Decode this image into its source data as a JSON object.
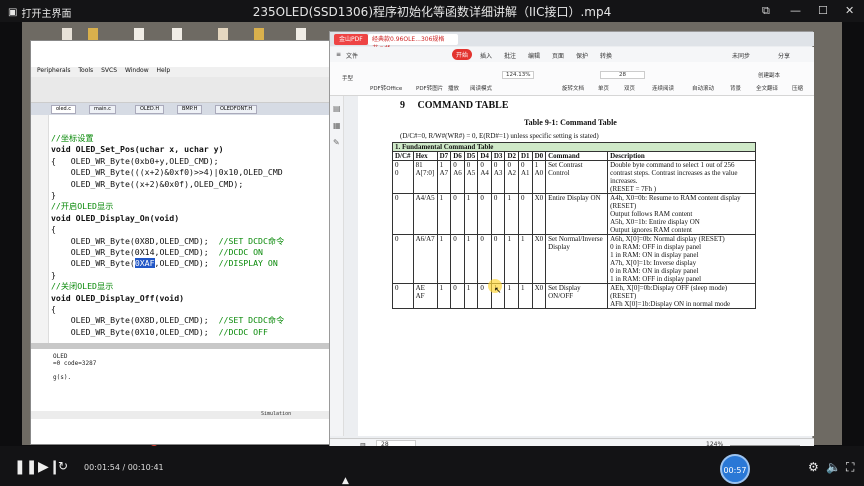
{
  "window": {
    "title": "235OLED(SSD1306)程序初始化等函数详细讲解（IIC接口）.mp4",
    "home_label": "打开主界面"
  },
  "ide": {
    "menu": [
      "Peripherals",
      "Tools",
      "SVCS",
      "Window",
      "Help"
    ],
    "tabs": [
      "oled.c",
      "main.c",
      "OLED.H",
      "BMP.H",
      "OLEDFONT.H"
    ],
    "code_lines": [
      {
        "type": "comment",
        "text": "//坐标设置"
      },
      {
        "type": "kw",
        "text": "void OLED_Set_Pos(uchar x, uchar y)"
      },
      {
        "type": "plain",
        "text": "{   OLED_WR_Byte(0xb0+y,OLED_CMD);"
      },
      {
        "type": "plain",
        "text": "    OLED_WR_Byte(((x+2)&0xf0)>>4)|0x10,OLED_CMD"
      },
      {
        "type": "plain",
        "text": "    OLED_WR_Byte((x+2)&0x0f),OLED_CMD);"
      },
      {
        "type": "plain",
        "text": "}"
      },
      {
        "type": "comment",
        "text": "//开启OLED显示"
      },
      {
        "type": "kw",
        "text": "void OLED_Display_On(void)"
      },
      {
        "type": "plain",
        "text": "{"
      },
      {
        "type": "mixed",
        "pre": "    OLED_WR_Byte(0X8D,OLED_CMD);  ",
        "post": "//SET DCDC命令"
      },
      {
        "type": "mixed",
        "pre": "    OLED_WR_Byte(0X14,OLED_CMD);  ",
        "post": "//DCDC ON"
      },
      {
        "type": "hl",
        "pre": "    OLED_WR_Byte(",
        "hl": "0XAF",
        "mid": ",OLED_CMD);  ",
        "post": "//DISPLAY ON"
      },
      {
        "type": "plain",
        "text": "}"
      },
      {
        "type": "comment",
        "text": "//关闭OLED显示"
      },
      {
        "type": "kw",
        "text": "void OLED_Display_Off(void)"
      },
      {
        "type": "plain",
        "text": "{"
      },
      {
        "type": "mixed",
        "pre": "    OLED_WR_Byte(0X8D,OLED_CMD);  ",
        "post": "//SET DCDC命令"
      },
      {
        "type": "mixed",
        "pre": "    OLED_WR_Byte(0X10,OLED_CMD);  ",
        "post": "//DCDC OFF"
      }
    ],
    "build_output": [
      "OLED",
      "=0  code=3287",
      "",
      "g(s)."
    ],
    "status": "Simulation"
  },
  "pdf": {
    "wps_tab": "金山PDF",
    "doc_tab": "经典款0.96OLE...306规格书.pdf",
    "menu": [
      "文件",
      "开始",
      "插入",
      "批注",
      "编辑",
      "页面",
      "保护",
      "转换"
    ],
    "menu_right": [
      "未同步",
      "分享"
    ],
    "ribbon": [
      "手型",
      "PDF转Office",
      "PDF转图片",
      "播放",
      "阅读模式",
      "124.13%",
      "旋转文档",
      "单页",
      "双页",
      "连续阅读",
      "自动滚动",
      "背景",
      "全文翻译",
      "压缩",
      "创建副本"
    ],
    "page_input": "28",
    "section": "9     COMMAND TABLE",
    "table_title": "Table 9-1: Command Table",
    "table_subtitle": "(D/C#=0, R/W#(WR#) = 0, E(RD#=1) unless specific setting is stated)",
    "fundamental": "1. Fundamental Command Table",
    "headers": [
      "D/C#",
      "Hex",
      "D7",
      "D6",
      "D5",
      "D4",
      "D3",
      "D2",
      "D1",
      "D0",
      "Command",
      "Description"
    ],
    "rows": [
      {
        "dc": "0\n0",
        "hex": "81\nA[7:0]",
        "bits": [
          "1\nA7",
          "0\nA6",
          "0\nA5",
          "0\nA4",
          "0\nA3",
          "0\nA2",
          "0\nA1",
          "1\nA0"
        ],
        "cmd": "Set Contrast Control",
        "desc": "Double byte command to select 1 out of 256 contrast steps. Contrast increases as the value increases.\n(RESET = 7Fh )"
      },
      {
        "dc": "0",
        "hex": "A4/A5",
        "bits": [
          "1",
          "0",
          "1",
          "0",
          "0",
          "1",
          "0",
          "X0"
        ],
        "cmd": "Entire Display ON",
        "desc": "A4h, X0=0b: Resume to RAM content display (RESET)\n   Output follows RAM content\nA5h, X0=1b: Entire display ON\n   Output ignores RAM content"
      },
      {
        "dc": "0",
        "hex": "A6/A7",
        "bits": [
          "1",
          "0",
          "1",
          "0",
          "0",
          "1",
          "1",
          "X0"
        ],
        "cmd": "Set Normal/Inverse Display",
        "desc": "A6h, X[0]=0b: Normal display (RESET)\n   0 in RAM: OFF in display panel\n   1 in RAM: ON in display panel\nA7h, X[0]=1b: Inverse display\n   0 in RAM: ON in display panel\n   1 in RAM: OFF in display panel"
      },
      {
        "dc": "0",
        "hex": "AE\nAF",
        "bits": [
          "1",
          "0",
          "1",
          "0",
          "1",
          "1",
          "1",
          "X0"
        ],
        "cmd": "Set Display ON/OFF",
        "desc": "AEh, X[0]=0b:Display OFF (sleep mode) (RESET)\nAFh X[0]=1b:Display ON in normal mode"
      }
    ],
    "footer_page": "28",
    "footer_zoom": "124%"
  },
  "player": {
    "current_time": "00:01:54",
    "total_time": "00:10:41",
    "time_separator": " / ",
    "speed_badge": "00:57",
    "progress": 0.178
  }
}
